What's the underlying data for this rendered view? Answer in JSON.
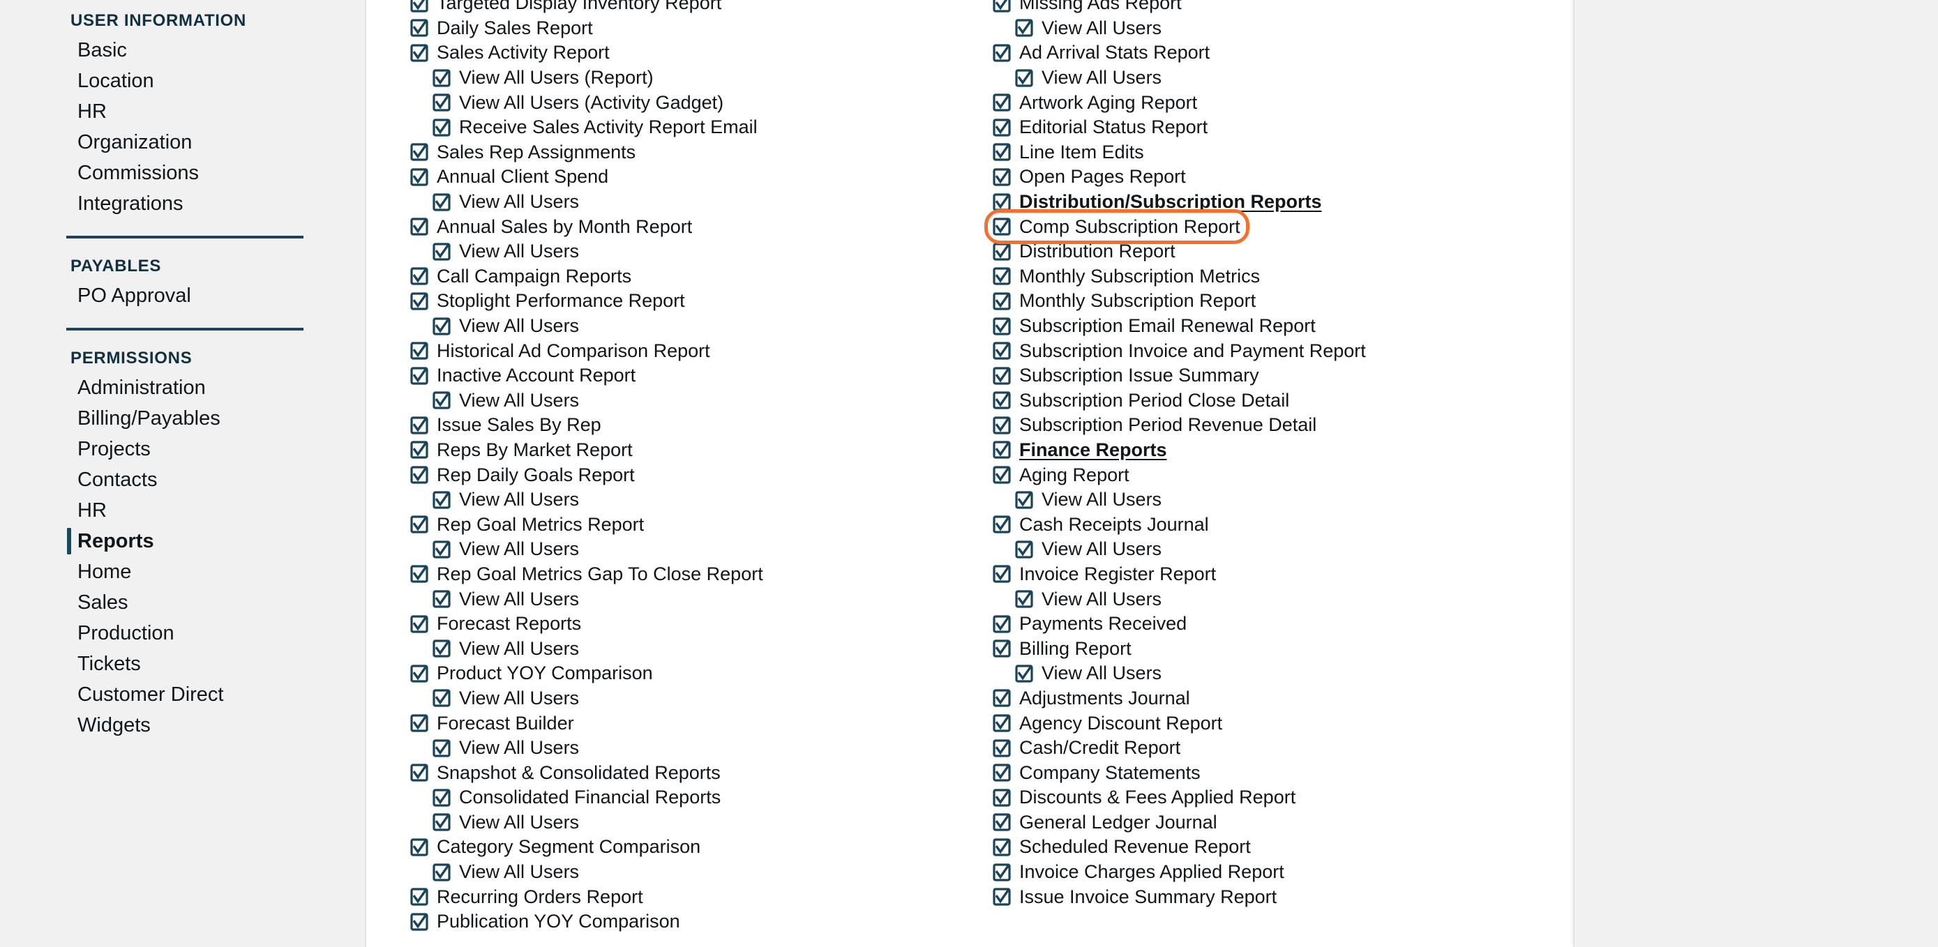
{
  "theme": {
    "sidebar_bg": "#f1f1f1",
    "content_bg": "#ffffff",
    "checkbox_color": "#1b4359",
    "divider_color": "#1b4359",
    "active_indicator_color": "#164a63",
    "highlight_color": "#F2712F",
    "text_color": "#111518"
  },
  "sidebar": {
    "groups": [
      {
        "title": "USER INFORMATION",
        "items": [
          {
            "label": "Basic",
            "active": false
          },
          {
            "label": "Location",
            "active": false
          },
          {
            "label": "HR",
            "active": false
          },
          {
            "label": "Organization",
            "active": false
          },
          {
            "label": "Commissions",
            "active": false
          },
          {
            "label": "Integrations",
            "active": false
          }
        ]
      },
      {
        "title": "PAYABLES",
        "items": [
          {
            "label": "PO Approval",
            "active": false
          }
        ]
      },
      {
        "title": "PERMISSIONS",
        "items": [
          {
            "label": "Administration",
            "active": false
          },
          {
            "label": "Billing/Payables",
            "active": false
          },
          {
            "label": "Projects",
            "active": false
          },
          {
            "label": "Contacts",
            "active": false
          },
          {
            "label": "HR",
            "active": false
          },
          {
            "label": "Reports",
            "active": true
          },
          {
            "label": "Home",
            "active": false
          },
          {
            "label": "Sales",
            "active": false
          },
          {
            "label": "Production",
            "active": false
          },
          {
            "label": "Tickets",
            "active": false
          },
          {
            "label": "Customer Direct",
            "active": false
          },
          {
            "label": "Widgets",
            "active": false
          }
        ]
      }
    ]
  },
  "middle_column": {
    "rows": [
      {
        "label": "Targeted Display Inventory Report",
        "indent": 0,
        "checked": true,
        "header": false,
        "clipped_top": true
      },
      {
        "label": "Daily Sales Report",
        "indent": 0,
        "checked": true,
        "header": false
      },
      {
        "label": "Sales Activity Report",
        "indent": 0,
        "checked": true,
        "header": false
      },
      {
        "label": "View All Users (Report)",
        "indent": 1,
        "checked": true,
        "header": false
      },
      {
        "label": "View All Users (Activity Gadget)",
        "indent": 1,
        "checked": true,
        "header": false
      },
      {
        "label": "Receive Sales Activity Report Email",
        "indent": 1,
        "checked": true,
        "header": false
      },
      {
        "label": "Sales Rep Assignments",
        "indent": 0,
        "checked": true,
        "header": false
      },
      {
        "label": "Annual Client Spend",
        "indent": 0,
        "checked": true,
        "header": false
      },
      {
        "label": "View All Users",
        "indent": 1,
        "checked": true,
        "header": false
      },
      {
        "label": "Annual Sales by Month Report",
        "indent": 0,
        "checked": true,
        "header": false
      },
      {
        "label": "View All Users",
        "indent": 1,
        "checked": true,
        "header": false
      },
      {
        "label": "Call Campaign Reports",
        "indent": 0,
        "checked": true,
        "header": false
      },
      {
        "label": "Stoplight Performance Report",
        "indent": 0,
        "checked": true,
        "header": false
      },
      {
        "label": "View All Users",
        "indent": 1,
        "checked": true,
        "header": false
      },
      {
        "label": "Historical Ad Comparison Report",
        "indent": 0,
        "checked": true,
        "header": false
      },
      {
        "label": "Inactive Account Report",
        "indent": 0,
        "checked": true,
        "header": false
      },
      {
        "label": "View All Users",
        "indent": 1,
        "checked": true,
        "header": false
      },
      {
        "label": "Issue Sales By Rep",
        "indent": 0,
        "checked": true,
        "header": false
      },
      {
        "label": "Reps By Market Report",
        "indent": 0,
        "checked": true,
        "header": false
      },
      {
        "label": "Rep Daily Goals Report",
        "indent": 0,
        "checked": true,
        "header": false
      },
      {
        "label": "View All Users",
        "indent": 1,
        "checked": true,
        "header": false
      },
      {
        "label": "Rep Goal Metrics Report",
        "indent": 0,
        "checked": true,
        "header": false
      },
      {
        "label": "View All Users",
        "indent": 1,
        "checked": true,
        "header": false
      },
      {
        "label": "Rep Goal Metrics Gap To Close Report",
        "indent": 0,
        "checked": true,
        "header": false
      },
      {
        "label": "View All Users",
        "indent": 1,
        "checked": true,
        "header": false
      },
      {
        "label": "Forecast Reports",
        "indent": 0,
        "checked": true,
        "header": false
      },
      {
        "label": "View All Users",
        "indent": 1,
        "checked": true,
        "header": false
      },
      {
        "label": "Product YOY Comparison",
        "indent": 0,
        "checked": true,
        "header": false
      },
      {
        "label": "View All Users",
        "indent": 1,
        "checked": true,
        "header": false
      },
      {
        "label": "Forecast Builder",
        "indent": 0,
        "checked": true,
        "header": false
      },
      {
        "label": "View All Users",
        "indent": 1,
        "checked": true,
        "header": false
      },
      {
        "label": "Snapshot & Consolidated Reports",
        "indent": 0,
        "checked": true,
        "header": false
      },
      {
        "label": "Consolidated Financial Reports",
        "indent": 1,
        "checked": true,
        "header": false
      },
      {
        "label": "View All Users",
        "indent": 1,
        "checked": true,
        "header": false
      },
      {
        "label": "Category Segment Comparison",
        "indent": 0,
        "checked": true,
        "header": false
      },
      {
        "label": "View All Users",
        "indent": 1,
        "checked": true,
        "header": false
      },
      {
        "label": "Recurring Orders Report",
        "indent": 0,
        "checked": true,
        "header": false
      },
      {
        "label": "Publication YOY Comparison",
        "indent": 0,
        "checked": true,
        "header": false,
        "clipped_bottom": true
      }
    ]
  },
  "right_column": {
    "rows": [
      {
        "label": "Missing Ads Report",
        "indent": 0,
        "checked": true,
        "header": false,
        "clipped_top": true
      },
      {
        "label": "View All Users",
        "indent": 1,
        "checked": true,
        "header": false
      },
      {
        "label": "Ad Arrival Stats Report",
        "indent": 0,
        "checked": true,
        "header": false
      },
      {
        "label": "View All Users",
        "indent": 1,
        "checked": true,
        "header": false
      },
      {
        "label": "Artwork Aging Report",
        "indent": 0,
        "checked": true,
        "header": false
      },
      {
        "label": "Editorial Status Report",
        "indent": 0,
        "checked": true,
        "header": false
      },
      {
        "label": "Line Item Edits",
        "indent": 0,
        "checked": true,
        "header": false
      },
      {
        "label": "Open Pages Report",
        "indent": 0,
        "checked": true,
        "header": false
      },
      {
        "label": "Distribution/Subscription Reports",
        "indent": -1,
        "checked": true,
        "header": true
      },
      {
        "label": "Comp Subscription Report",
        "indent": 0,
        "checked": true,
        "header": false,
        "highlighted": true
      },
      {
        "label": "Distribution Report",
        "indent": 0,
        "checked": true,
        "header": false
      },
      {
        "label": "Monthly Subscription Metrics",
        "indent": 0,
        "checked": true,
        "header": false
      },
      {
        "label": "Monthly Subscription Report",
        "indent": 0,
        "checked": true,
        "header": false
      },
      {
        "label": "Subscription Email Renewal Report",
        "indent": 0,
        "checked": true,
        "header": false
      },
      {
        "label": "Subscription Invoice and Payment Report",
        "indent": 0,
        "checked": true,
        "header": false
      },
      {
        "label": "Subscription Issue Summary",
        "indent": 0,
        "checked": true,
        "header": false
      },
      {
        "label": "Subscription Period Close Detail",
        "indent": 0,
        "checked": true,
        "header": false
      },
      {
        "label": "Subscription Period Revenue Detail",
        "indent": 0,
        "checked": true,
        "header": false
      },
      {
        "label": "Finance Reports",
        "indent": -1,
        "checked": true,
        "header": true
      },
      {
        "label": "Aging Report",
        "indent": 0,
        "checked": true,
        "header": false
      },
      {
        "label": "View All Users",
        "indent": 1,
        "checked": true,
        "header": false
      },
      {
        "label": "Cash Receipts Journal",
        "indent": 0,
        "checked": true,
        "header": false
      },
      {
        "label": "View All Users",
        "indent": 1,
        "checked": true,
        "header": false
      },
      {
        "label": "Invoice Register Report",
        "indent": 0,
        "checked": true,
        "header": false
      },
      {
        "label": "View All Users",
        "indent": 1,
        "checked": true,
        "header": false
      },
      {
        "label": "Payments Received",
        "indent": 0,
        "checked": true,
        "header": false
      },
      {
        "label": "Billing Report",
        "indent": 0,
        "checked": true,
        "header": false
      },
      {
        "label": "View All Users",
        "indent": 1,
        "checked": true,
        "header": false
      },
      {
        "label": "Adjustments Journal",
        "indent": 0,
        "checked": true,
        "header": false
      },
      {
        "label": "Agency Discount Report",
        "indent": 0,
        "checked": true,
        "header": false
      },
      {
        "label": "Cash/Credit Report",
        "indent": 0,
        "checked": true,
        "header": false
      },
      {
        "label": "Company Statements",
        "indent": 0,
        "checked": true,
        "header": false
      },
      {
        "label": "Discounts & Fees Applied Report",
        "indent": 0,
        "checked": true,
        "header": false
      },
      {
        "label": "General Ledger Journal",
        "indent": 0,
        "checked": true,
        "header": false
      },
      {
        "label": "Scheduled Revenue Report",
        "indent": 0,
        "checked": true,
        "header": false
      },
      {
        "label": "Invoice Charges Applied Report",
        "indent": 0,
        "checked": true,
        "header": false
      },
      {
        "label": "Issue Invoice Summary Report",
        "indent": 0,
        "checked": true,
        "header": false
      }
    ]
  },
  "right_panel": {
    "visible": true
  }
}
